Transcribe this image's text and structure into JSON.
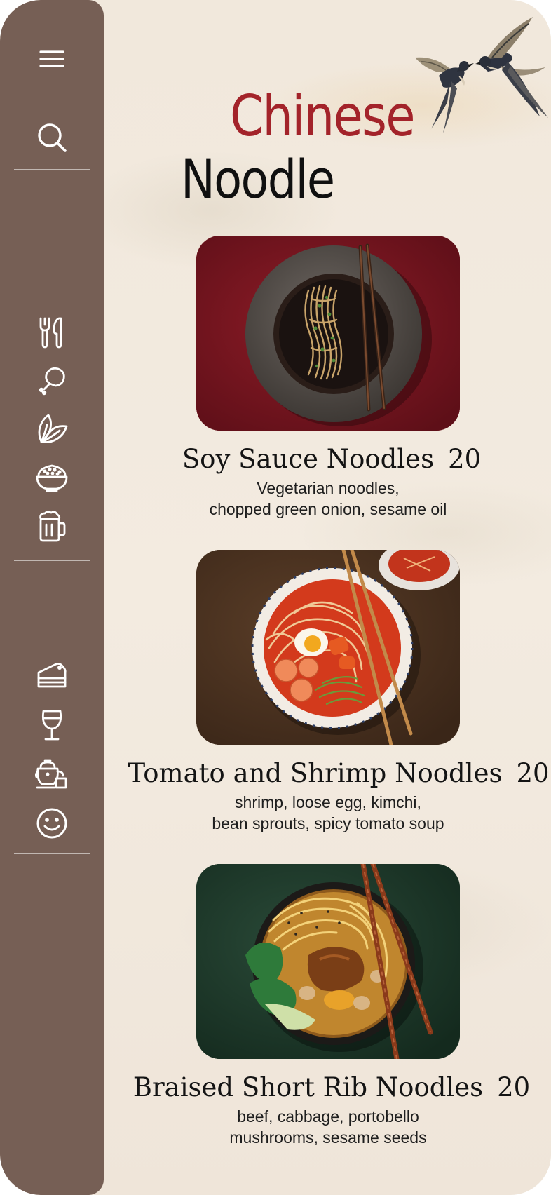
{
  "header": {
    "title_line1": "Chinese",
    "title_line2": "Noodle",
    "accent_color": "#a3232a",
    "decoration": "swallows-illustration"
  },
  "sidebar": {
    "background": "#765f55",
    "items": [
      {
        "icon": "menu-icon"
      },
      {
        "icon": "search-icon"
      },
      {
        "icon": "utensils-icon"
      },
      {
        "icon": "drumstick-icon"
      },
      {
        "icon": "leaf-icon"
      },
      {
        "icon": "noodle-bowl-icon"
      },
      {
        "icon": "beer-mug-icon"
      },
      {
        "icon": "cake-icon"
      },
      {
        "icon": "wine-glass-icon"
      },
      {
        "icon": "teapot-icon"
      },
      {
        "icon": "smiley-icon"
      }
    ]
  },
  "menu": {
    "items": [
      {
        "name": "Soy Sauce Noodles",
        "price": "20",
        "desc_line1": "Vegetarian noodles,",
        "desc_line2": "chopped green onion, sesame oil",
        "photo_bg": "#7a1620"
      },
      {
        "name": "Tomato and Shrimp Noodles",
        "price": "20",
        "desc_line1": "shrimp, loose egg, kimchi,",
        "desc_line2": "bean sprouts, spicy tomato soup",
        "photo_bg": "#4a3222"
      },
      {
        "name": "Braised Short Rib Noodles",
        "price": "20",
        "desc_line1": "beef, cabbage, portobello",
        "desc_line2": "mushrooms, sesame seeds",
        "photo_bg": "#1f3a2c"
      }
    ]
  }
}
